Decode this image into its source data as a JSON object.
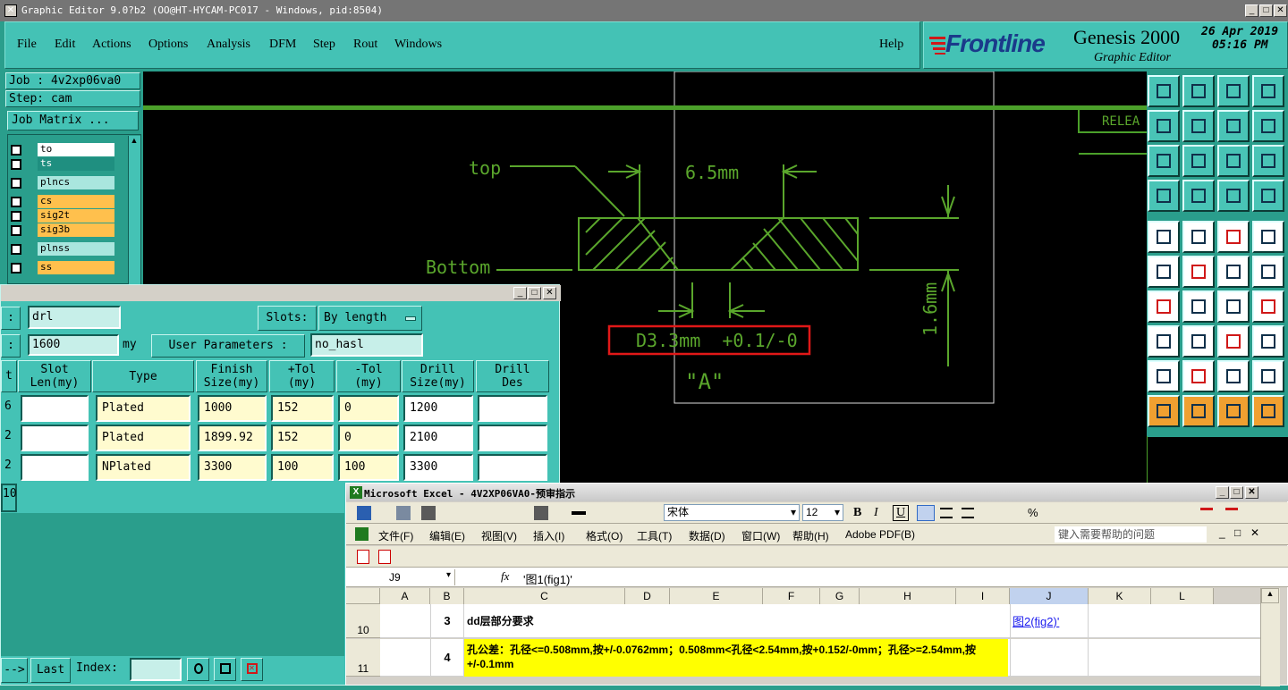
{
  "window": {
    "title": "Graphic Editor 9.0?b2 (OO@HT-HYCAM-PC017 - Windows, pid:8504)"
  },
  "menu": {
    "items": [
      "File",
      "Edit",
      "Actions",
      "Options",
      "Analysis",
      "DFM",
      "Step",
      "Rout",
      "Windows"
    ],
    "help": "Help"
  },
  "brand": {
    "logo": "Frontline",
    "product": "Genesis 2000",
    "subtitle": "Graphic Editor",
    "date": "26 Apr 2019",
    "time": "05:16 PM"
  },
  "job": {
    "label": "Job : 4v2xp06va0",
    "step": "Step: cam",
    "matrix_button": "Job Matrix ..."
  },
  "layers": [
    {
      "name": "to",
      "color": "#ffffff"
    },
    {
      "name": "ts",
      "color": "#1f8f80"
    },
    {
      "name": "plncs",
      "color": "#a9e6de"
    },
    {
      "name": "cs",
      "color": "#ffc04d"
    },
    {
      "name": "sig2t",
      "color": "#ffc04d"
    },
    {
      "name": "sig3b",
      "color": "#ffc04d"
    },
    {
      "name": "plnss",
      "color": "#a9e6de"
    },
    {
      "name": "ss",
      "color": "#ffc04d"
    }
  ],
  "drawing": {
    "top": "top",
    "bottom": "Bottom",
    "width": "6.5mm",
    "thickness": "1.6mm",
    "diameter": "D3.3mm  +0.1/-0",
    "view": "\"A\"",
    "note": "RELEA"
  },
  "drill": {
    "layer_value": "drl",
    "slots_label": "Slots:",
    "slots_value": "By length",
    "thickness_value": "1600",
    "thickness_unit": "my",
    "user_params_button": "User Parameters :",
    "user_params_value": "no_hasl",
    "headers": [
      "Slot\nLen(my)",
      "Type",
      "Finish\nSize(my)",
      "+Tol\n(my)",
      "-Tol\n(my)",
      "Drill\nSize(my)",
      "Drill\nDes"
    ],
    "rows": [
      {
        "count": "6",
        "slot": "",
        "type": "Plated",
        "finish": "1000",
        "ptol": "152",
        "ntol": "0",
        "drill": "1200",
        "des": ""
      },
      {
        "count": "2",
        "slot": "",
        "type": "Plated",
        "finish": "1899.92",
        "ptol": "152",
        "ntol": "0",
        "drill": "2100",
        "des": ""
      },
      {
        "count": "2",
        "slot": "",
        "type": "NPlated",
        "finish": "3300",
        "ptol": "100",
        "ntol": "100",
        "drill": "3300",
        "des": ""
      }
    ],
    "total": "10",
    "last_button": "Last",
    "arrow_button": "-->",
    "index_label": "Index:"
  },
  "excel": {
    "title": "Microsoft Excel - 4V2XP06VA0-预审指示",
    "font": "宋体",
    "size": "12",
    "menus": [
      "文件(F)",
      "编辑(E)",
      "视图(V)",
      "插入(I)",
      "格式(O)",
      "工具(T)",
      "数据(D)",
      "窗口(W)",
      "帮助(H)",
      "Adobe PDF(B)"
    ],
    "help_placeholder": "键入需要帮助的问题",
    "cell_ref": "J9",
    "formula": "'图1(fig1)'",
    "columns": [
      "A",
      "B",
      "C",
      "D",
      "E",
      "F",
      "G",
      "H",
      "I",
      "J",
      "K",
      "L"
    ],
    "rows": [
      {
        "num": "10",
        "b": "3",
        "c": "dd层部分要求",
        "j": "图2(fig2)'"
      },
      {
        "num": "11",
        "b": "4",
        "c": "孔公差：孔径<=0.508mm,按+/-0.0762mm；0.508mm<孔径<2.54mm,按+0.152/-0mm；孔径>=2.54mm,按+/-0.1mm",
        "j": ""
      }
    ]
  }
}
